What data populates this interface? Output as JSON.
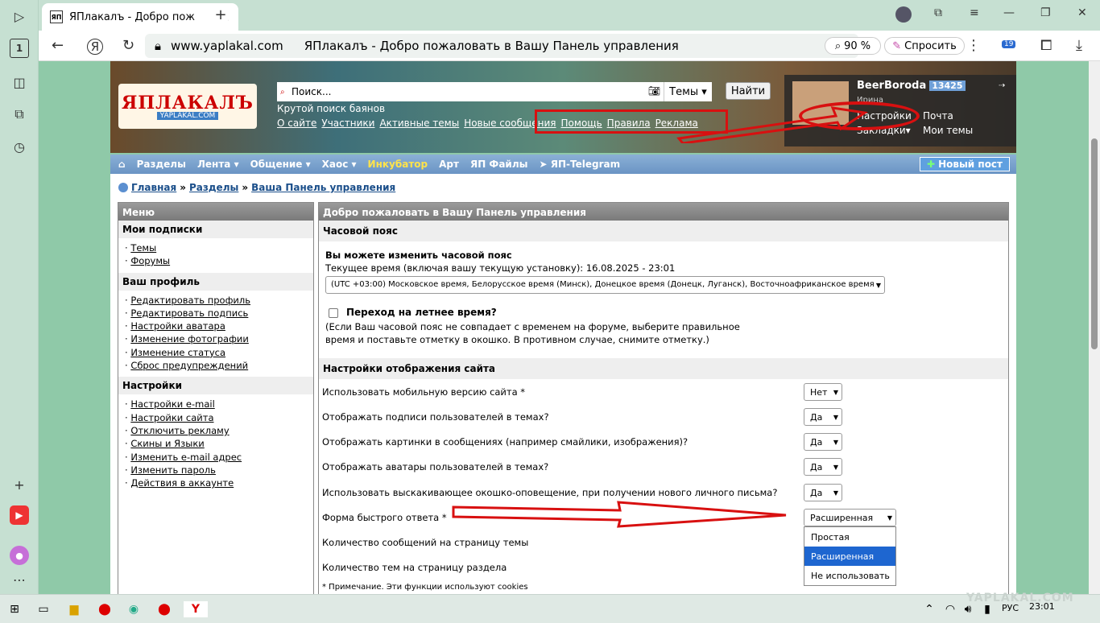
{
  "browser": {
    "tab_title": "ЯПлакалъ - Добро пож",
    "url_domain": "www.yaplakal.com",
    "page_title": "ЯПлакалъ - Добро пожаловать в Вашу Панель управления",
    "zoom": "90 %",
    "ask_label": "Спросить",
    "downloads_badge": "19"
  },
  "header": {
    "logo": "ЯПЛАКАЛЪ",
    "logo_sub": "YAPLAKAL.COM",
    "search_placeholder": "Поиск...",
    "search_scope": "Темы",
    "find_button": "Найти",
    "slogan": "Крутой поиск баянов",
    "links": [
      "О сайте",
      "Участники",
      "Активные темы",
      "Новые сообщения",
      "Помощь",
      "Правила",
      "Реклама"
    ]
  },
  "user": {
    "name": "BeerBoroda",
    "rating": "13425",
    "status": "Ирина",
    "settings": "Настройки",
    "mail": "Почта",
    "bookmarks": "Закладки",
    "my_topics": "Мои темы"
  },
  "nav": {
    "items": [
      "Разделы",
      "Лента",
      "Общение",
      "Хаос",
      "Инкубатор",
      "Арт",
      "ЯП Файлы",
      "ЯП-Telegram"
    ],
    "new_post": "Новый пост"
  },
  "breadcrumb": [
    "Главная",
    "Разделы",
    "Ваша Панель управления"
  ],
  "menu": {
    "title": "Меню",
    "subs_title": "Мои подписки",
    "subs": [
      "Темы",
      "Форумы"
    ],
    "profile_title": "Ваш профиль",
    "profile": [
      "Редактировать профиль",
      "Редактировать подпись",
      "Настройки аватара",
      "Изменение фотографии",
      "Изменение статуса",
      "Сброс предупреждений"
    ],
    "settings_title": "Настройки",
    "settings": [
      "Настройки e-mail",
      "Настройки сайта",
      "Отключить рекламу",
      "Скины и Языки",
      "Изменить e-mail адрес",
      "Изменить пароль",
      "Действия в аккаунте"
    ]
  },
  "main": {
    "title": "Добро пожаловать в Вашу Панель управления",
    "tz_title": "Часовой пояс",
    "tz_can": "Вы можете изменить часовой пояс",
    "tz_current": "Текущее время (включая вашу текущую установку): 16.08.2025 - 23:01",
    "tz_value": "(UTC +03:00) Московское время, Белорусское время (Минск), Донецкое время (Донецк, Луганск), Восточноафриканское время",
    "dst_label": "Переход на летнее время?",
    "dst_note1": "(Если Ваш часовой пояс не совпадает с временем на форуме, выберите правильное",
    "dst_note2": "время и поставьте отметку в окошко. В противном случае, снимите отметку.)",
    "display_title": "Настройки отображения сайта",
    "rows": [
      {
        "label": "Использовать мобильную версию сайта *",
        "value": "Нет"
      },
      {
        "label": "Отображать подписи пользователей в темах?",
        "value": "Да"
      },
      {
        "label": "Отображать картинки в сообщениях (например смайлики, изображения)?",
        "value": "Да"
      },
      {
        "label": "Отображать аватары пользователей в темах?",
        "value": "Да"
      },
      {
        "label": "Использовать выскакивающее окошко-оповещение, при получении нового личного письма?",
        "value": "Да"
      },
      {
        "label": "Форма быстрого ответа *",
        "value": "Расширенная"
      },
      {
        "label": "Количество сообщений на страницу темы",
        "value": ""
      },
      {
        "label": "Количество тем на страницу раздела",
        "value": ""
      }
    ],
    "dropdown_options": [
      "Простая",
      "Расширенная",
      "Не использовать"
    ],
    "note": "* Примечание. Эти функции используют cookies"
  },
  "taskbar": {
    "lang": "РУС",
    "time": "23:01",
    "watermark": "YAPLAKAL.COM"
  },
  "colors": {
    "annotation_red": "#d81010",
    "nav_blue": "#6a94c4",
    "selected_blue": "#1e66d0"
  }
}
